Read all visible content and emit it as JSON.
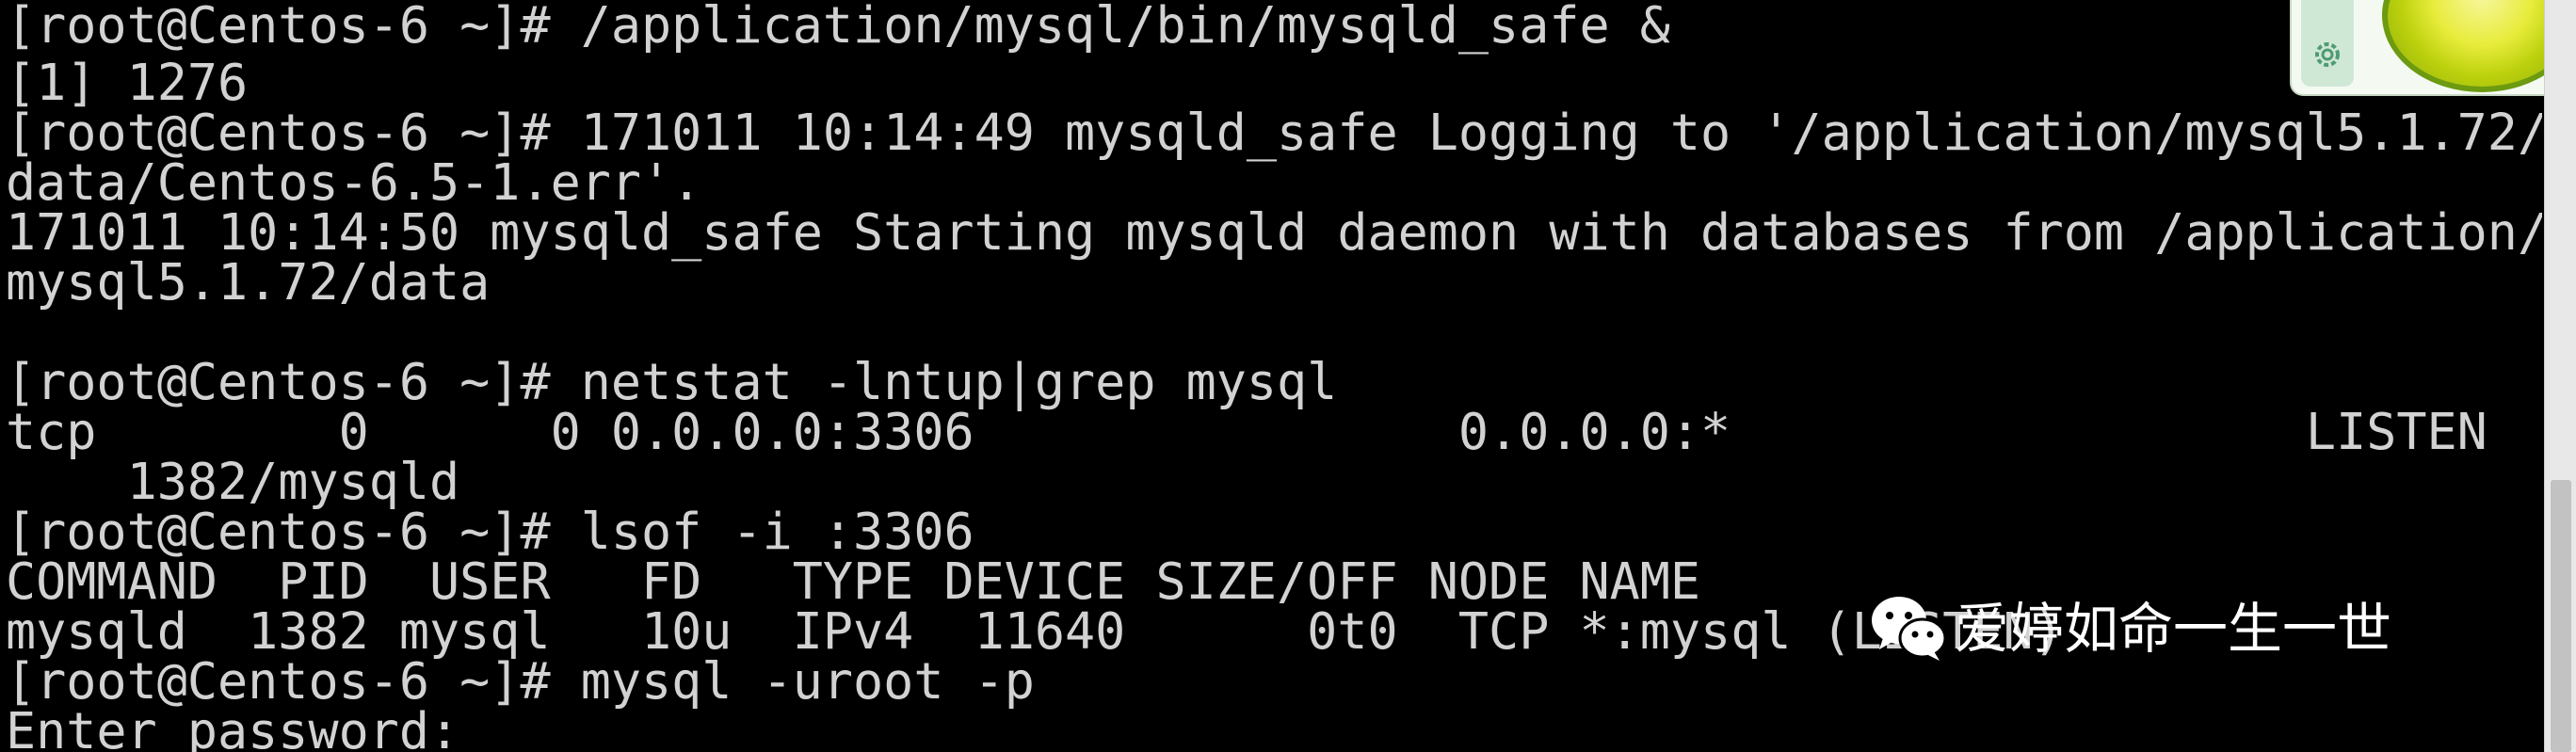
{
  "terminal": {
    "lines": [
      "[root@Centos-6 ~]# /application/mysql/bin/mysqld_safe &",
      "[1] 1276",
      "[root@Centos-6 ~]# 171011 10:14:49 mysqld_safe Logging to '/application/mysql5.1.72/",
      "data/Centos-6.5-1.err'.",
      "171011 10:14:50 mysqld_safe Starting mysqld daemon with databases from /application/",
      "mysql5.1.72/data",
      "",
      "[root@Centos-6 ~]# netstat -lntup|grep mysql",
      "tcp        0      0 0.0.0.0:3306                0.0.0.0:*                   LISTEN",
      "    1382/mysqld",
      "[root@Centos-6 ~]# lsof -i :3306",
      "COMMAND  PID  USER   FD   TYPE DEVICE SIZE/OFF NODE NAME",
      "mysqld  1382 mysql   10u  IPv4  11640      0t0  TCP *:mysql (LISTEN)",
      "[root@Centos-6 ~]# mysql -uroot -p",
      "Enter password:"
    ]
  },
  "watermark": {
    "text": "爱婷如命一生一世",
    "icon": "wechat-icon"
  },
  "popup": {
    "icon": "gear-icon"
  },
  "colors": {
    "background": "#000000",
    "text": "#d2d2d2",
    "scrollbar": "#e8e8e8"
  }
}
